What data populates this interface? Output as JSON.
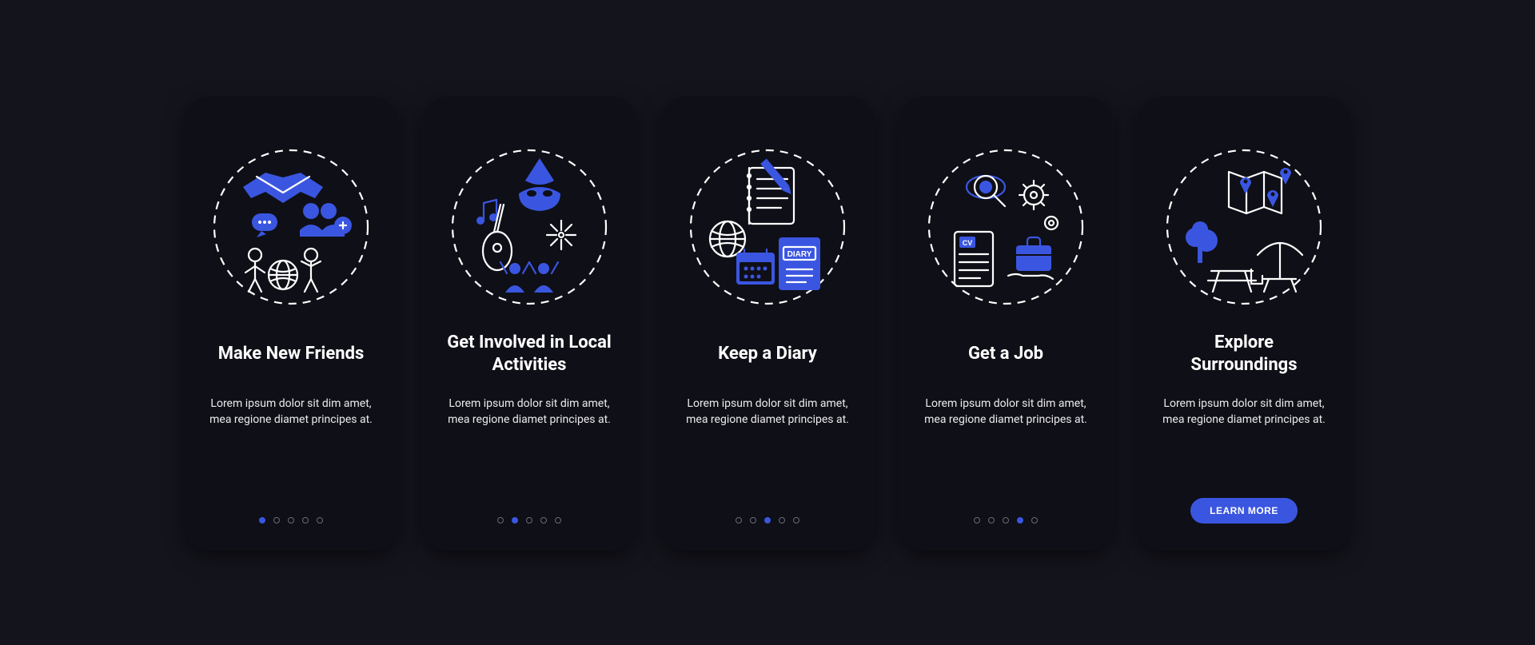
{
  "colors": {
    "accent": "#3a56e0",
    "background": "#14141c",
    "card": "#0f0f17",
    "text": "#ffffff"
  },
  "cards": [
    {
      "icon": "friends-icon",
      "title": "Make New Friends",
      "desc": "Lorem ipsum dolor sit dim amet, mea regione diamet principes at.",
      "active_index": 0,
      "has_button": false
    },
    {
      "icon": "activities-icon",
      "title": "Get Involved in Local Activities",
      "desc": "Lorem ipsum dolor sit dim amet, mea regione diamet principes at.",
      "active_index": 1,
      "has_button": false
    },
    {
      "icon": "diary-icon",
      "title": "Keep a Diary",
      "desc": "Lorem ipsum dolor sit dim amet, mea regione diamet principes at.",
      "active_index": 2,
      "has_button": false
    },
    {
      "icon": "job-icon",
      "title": "Get a Job",
      "desc": "Lorem ipsum dolor sit dim amet, mea regione diamet principes at.",
      "active_index": 3,
      "has_button": false
    },
    {
      "icon": "explore-icon",
      "title": "Explore Surroundings",
      "desc": "Lorem ipsum dolor sit dim amet, mea regione diamet principes at.",
      "active_index": 4,
      "has_button": true,
      "button_label": "LEARN MORE"
    }
  ],
  "pager_count": 5
}
